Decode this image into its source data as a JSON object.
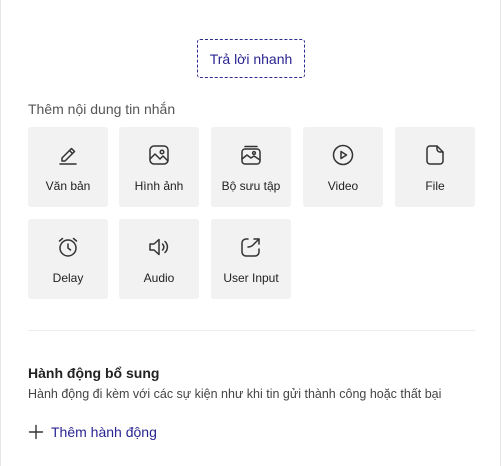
{
  "quick_reply": {
    "label": "Trả lời nhanh"
  },
  "content_section": {
    "label": "Thêm nội dung tin nhắn",
    "tiles": [
      {
        "label": "Văn bản",
        "icon": "pencil-icon"
      },
      {
        "label": "Hình ảnh",
        "icon": "image-icon"
      },
      {
        "label": "Bộ sưu tập",
        "icon": "gallery-icon"
      },
      {
        "label": "Video",
        "icon": "video-play-icon"
      },
      {
        "label": "File",
        "icon": "file-icon"
      },
      {
        "label": "Delay",
        "icon": "alarm-clock-icon"
      },
      {
        "label": "Audio",
        "icon": "speaker-icon"
      },
      {
        "label": "User Input",
        "icon": "share-arrow-icon"
      }
    ]
  },
  "extra_actions": {
    "title": "Hành động bổ sung",
    "description": "Hành động đi kèm với các sự kiện như khi tin gửi thành công hoặc thất bại",
    "add_label": "Thêm hành động",
    "add_icon": "plus-icon"
  },
  "colors": {
    "accent": "#2a2591",
    "tile_bg": "#f2f2f2",
    "icon_stroke": "#333333"
  }
}
